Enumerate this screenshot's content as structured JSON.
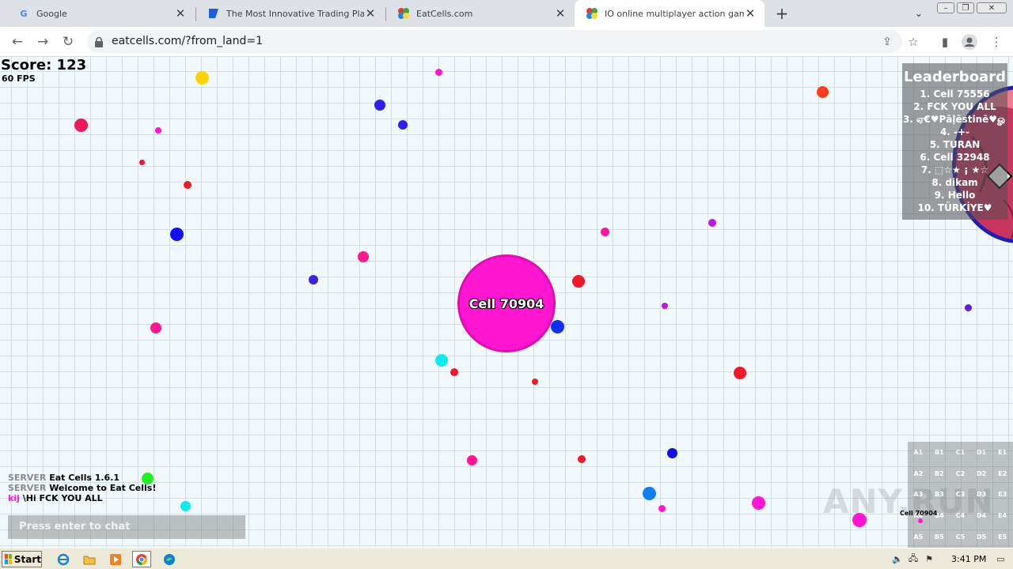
{
  "browser": {
    "tabs": [
      {
        "title": "Google",
        "icon": "google-icon",
        "active": false
      },
      {
        "title": "The Most Innovative Trading Platform",
        "icon": "trading-platform-icon",
        "active": false
      },
      {
        "title": "EatCells.com",
        "icon": "eatcells-icon",
        "active": false
      },
      {
        "title": "IO online multiplayer action game. Su",
        "icon": "eatcells-icon",
        "active": true
      }
    ],
    "new_tab_symbol": "+",
    "url": "eatcells.com/?from_land=1"
  },
  "game": {
    "score_label": "Score: 123",
    "fps_label": "60 FPS",
    "player_name": "Cell 70904",
    "player_color": "#ff16d0",
    "big_cell_name": "",
    "leaderboard": {
      "title": "Leaderboard",
      "items": [
        "1. Cell 75556",
        "2. FCK YOU ALL",
        "3. ஏ€♥Pāļēstinē♥ௐ",
        "4. -+-",
        "5. TURAN",
        "6. Cell 32948",
        "7. ⬚☆★ ¡ ★☆",
        "8. dikam",
        "9. Hello",
        "10. TÜRKİYE♥"
      ]
    },
    "chat": [
      {
        "sender": "SERVER",
        "message": "Eat Cells 1.6.1",
        "sender_color": "#8a8a8a"
      },
      {
        "sender": "SERVER",
        "message": "Welcome to Eat Cells!",
        "sender_color": "#8a8a8a"
      },
      {
        "sender": "kij",
        "message": "\\Hi FCK YOU ALL",
        "sender_color": "#ff16d0"
      }
    ],
    "chat_placeholder": "Press enter to chat",
    "minimap": {
      "cells": [
        "A1",
        "B1",
        "C1",
        "D1",
        "E1",
        "A2",
        "B2",
        "C2",
        "D2",
        "E2",
        "A3",
        "B3",
        "C3",
        "D3",
        "E3",
        "A4",
        "B4",
        "C4",
        "D4",
        "E4",
        "A5",
        "B5",
        "C5",
        "D5",
        "E5"
      ],
      "player_label": "Cell 70904"
    }
  },
  "watermark": "ANY.RUN",
  "taskbar": {
    "start_label": "Start",
    "clock": "3:41 PM"
  }
}
